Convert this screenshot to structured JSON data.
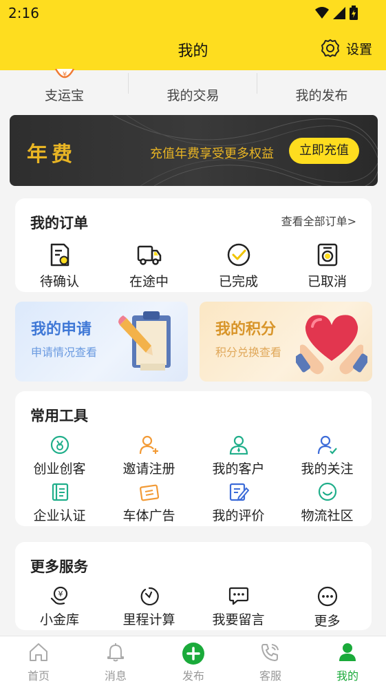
{
  "status": {
    "time": "2:16"
  },
  "header": {
    "title": "我的",
    "settings_label": "设置"
  },
  "top_tabs": [
    {
      "label": "支运宝"
    },
    {
      "label": "我的交易"
    },
    {
      "label": "我的发布"
    }
  ],
  "fee_banner": {
    "title": "年费",
    "subtitle": "充值年费享受更多权益",
    "button": "立即充值"
  },
  "orders": {
    "title": "我的订单",
    "view_all": "查看全部订单>",
    "items": [
      {
        "label": "待确认",
        "icon": "pending-doc-icon"
      },
      {
        "label": "在途中",
        "icon": "truck-icon"
      },
      {
        "label": "已完成",
        "icon": "check-circle-icon"
      },
      {
        "label": "已取消",
        "icon": "cancelled-doc-icon"
      }
    ]
  },
  "promos": [
    {
      "title": "我的申请",
      "subtitle": "申请情况查看",
      "icon": "clipboard-pencil-icon"
    },
    {
      "title": "我的积分",
      "subtitle": "积分兑换查看",
      "icon": "heart-hands-icon"
    }
  ],
  "tools": {
    "title": "常用工具",
    "items": [
      {
        "label": "创业创客",
        "icon": "medal-icon"
      },
      {
        "label": "邀请注册",
        "icon": "add-user-icon"
      },
      {
        "label": "我的客户",
        "icon": "customer-icon"
      },
      {
        "label": "我的关注",
        "icon": "follow-user-icon"
      },
      {
        "label": "企业认证",
        "icon": "certificate-icon"
      },
      {
        "label": "车体广告",
        "icon": "ad-card-icon"
      },
      {
        "label": "我的评价",
        "icon": "edit-note-icon"
      },
      {
        "label": "物流社区",
        "icon": "smile-icon"
      }
    ]
  },
  "services": {
    "title": "更多服务",
    "items": [
      {
        "label": "小金库",
        "icon": "coin-hand-icon"
      },
      {
        "label": "里程计算",
        "icon": "timer-icon"
      },
      {
        "label": "我要留言",
        "icon": "message-icon"
      },
      {
        "label": "更多",
        "icon": "more-icon"
      }
    ]
  },
  "bottom_nav": [
    {
      "label": "首页",
      "icon": "home-icon"
    },
    {
      "label": "消息",
      "icon": "bell-icon"
    },
    {
      "label": "发布",
      "icon": "plus-circle-icon"
    },
    {
      "label": "客服",
      "icon": "phone-icon"
    },
    {
      "label": "我的",
      "icon": "user-icon",
      "active": true
    }
  ],
  "colors": {
    "accent_yellow": "#fedd1f",
    "gold_text": "#e9b524",
    "tool_green": "#1fae8a",
    "tool_orange": "#f29a35",
    "tool_blue": "#3c6bd8",
    "nav_active_green": "#1aaa3a"
  }
}
